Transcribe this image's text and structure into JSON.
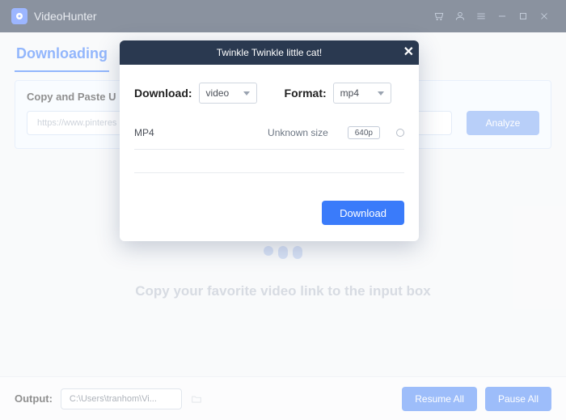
{
  "app": {
    "title": "VideoHunter"
  },
  "tab": {
    "heading": "Downloading"
  },
  "panel": {
    "label": "Copy and Paste U",
    "url_value": "https://www.pinteres",
    "analyze_label": "Analyze"
  },
  "empty": {
    "text": "Copy your favorite video link to the input box"
  },
  "footer": {
    "output_label": "Output:",
    "output_path": "C:\\Users\\tranhom\\Vi...",
    "resume_label": "Resume All",
    "pause_label": "Pause All"
  },
  "modal": {
    "title": "Twinkle Twinkle little cat!",
    "download_label": "Download:",
    "download_value": "video",
    "format_label": "Format:",
    "format_value": "mp4",
    "row": {
      "type": "MP4",
      "size": "Unknown size",
      "quality": "640p"
    },
    "action_label": "Download"
  }
}
